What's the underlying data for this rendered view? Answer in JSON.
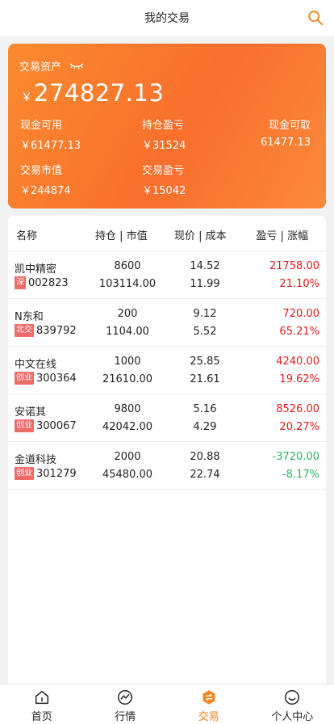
{
  "header": {
    "title": "我的交易"
  },
  "asset": {
    "label": "交易资产",
    "currency": "￥",
    "total": "274827.13",
    "stats": [
      {
        "label": "现金可用",
        "value": "￥61477.13"
      },
      {
        "label": "持仓盈亏",
        "value": "￥31524"
      },
      {
        "label": "现金可取",
        "value": "61477.13"
      },
      {
        "label": "交易市值",
        "value": "￥244874"
      },
      {
        "label": "交易盈亏",
        "value": "￥15042"
      }
    ]
  },
  "table": {
    "headers": [
      "名称",
      "持仓 | 市值",
      "现价 | 成本",
      "盈亏 | 涨幅"
    ],
    "rows": [
      {
        "name": "凯中精密",
        "market": "深",
        "code": "002823",
        "hold": "8600",
        "value": "103114.00",
        "price": "14.52",
        "cost": "11.99",
        "pnl": "21758.00",
        "pct": "21.10%",
        "trend": "up"
      },
      {
        "name": "N东和",
        "market": "北交",
        "code": "839792",
        "hold": "200",
        "value": "1104.00",
        "price": "9.12",
        "cost": "5.52",
        "pnl": "720.00",
        "pct": "65.21%",
        "trend": "up"
      },
      {
        "name": "中文在线",
        "market": "创业",
        "code": "300364",
        "hold": "1000",
        "value": "21610.00",
        "price": "25.85",
        "cost": "21.61",
        "pnl": "4240.00",
        "pct": "19.62%",
        "trend": "up"
      },
      {
        "name": "安诺其",
        "market": "创业",
        "code": "300067",
        "hold": "9800",
        "value": "42042.00",
        "price": "5.16",
        "cost": "4.29",
        "pnl": "8526.00",
        "pct": "20.27%",
        "trend": "up"
      },
      {
        "name": "金道科技",
        "market": "创业",
        "code": "301279",
        "hold": "2000",
        "value": "45480.00",
        "price": "20.88",
        "cost": "22.74",
        "pnl": "-3720.00",
        "pct": "-8.17%",
        "trend": "down"
      }
    ]
  },
  "nav": {
    "items": [
      {
        "label": "首页",
        "icon": "home-icon"
      },
      {
        "label": "行情",
        "icon": "market-chart-icon"
      },
      {
        "label": "交易",
        "icon": "exchange-icon",
        "active": true
      },
      {
        "label": "个人中心",
        "icon": "smile-user-icon"
      }
    ]
  },
  "colors": {
    "accent": "#f5841f",
    "up": "#e41c1c",
    "down": "#28b464",
    "tag": "#f06a6a"
  }
}
